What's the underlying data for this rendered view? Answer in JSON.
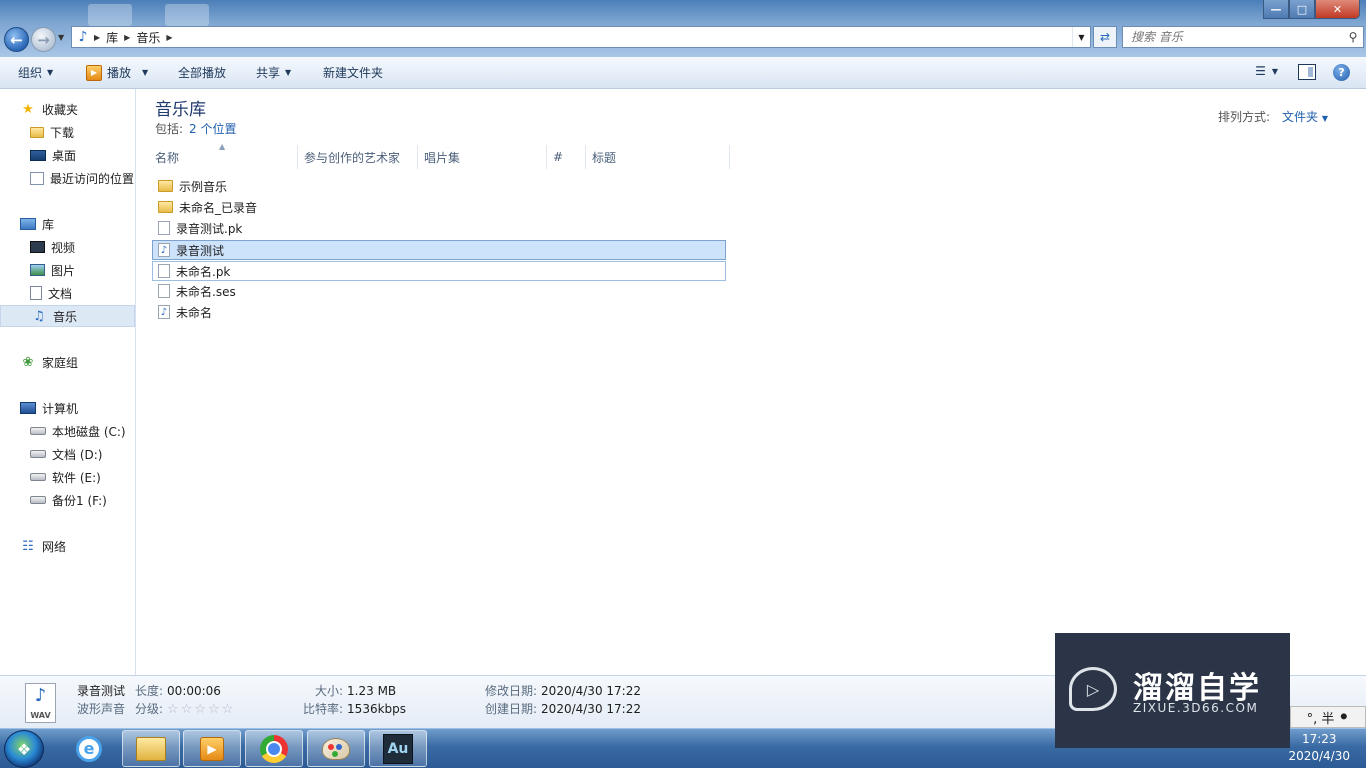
{
  "window": {
    "address_crumbs": [
      "库",
      "音乐"
    ],
    "search_placeholder": "搜索 音乐",
    "controls": {
      "minimize": "—",
      "maximize": "□",
      "close": "✕"
    }
  },
  "toolbar": {
    "organize": "组织",
    "play": "播放",
    "play_all": "全部播放",
    "share": "共享",
    "new_folder": "新建文件夹"
  },
  "sidebar": {
    "favorites": {
      "label": "收藏夹",
      "icon": "star-icon"
    },
    "favorites_items": [
      {
        "label": "下载",
        "icon": "download-folder-icon"
      },
      {
        "label": "桌面",
        "icon": "desktop-icon"
      },
      {
        "label": "最近访问的位置",
        "icon": "recent-places-icon"
      }
    ],
    "libraries": {
      "label": "库",
      "icon": "library-icon"
    },
    "library_items": [
      {
        "label": "视频",
        "icon": "video-library-icon"
      },
      {
        "label": "图片",
        "icon": "pictures-library-icon"
      },
      {
        "label": "文档",
        "icon": "documents-library-icon"
      },
      {
        "label": "音乐",
        "icon": "music-library-icon",
        "selected": true
      }
    ],
    "homegroup": {
      "label": "家庭组",
      "icon": "homegroup-icon"
    },
    "computer": {
      "label": "计算机",
      "icon": "computer-icon"
    },
    "drives": [
      {
        "label": "本地磁盘 (C:)",
        "icon": "system-drive-icon"
      },
      {
        "label": "文档 (D:)",
        "icon": "drive-icon"
      },
      {
        "label": "软件 (E:)",
        "icon": "drive-icon"
      },
      {
        "label": "备份1 (F:)",
        "icon": "drive-icon"
      }
    ],
    "network": {
      "label": "网络",
      "icon": "network-icon"
    }
  },
  "library": {
    "title": "音乐库",
    "includes_label": "包括:",
    "locations_link": "2 个位置",
    "sort_label": "排列方式:",
    "sort_value": "文件夹"
  },
  "columns": [
    "名称",
    "参与创作的艺术家",
    "唱片集",
    "#",
    "标题"
  ],
  "files": [
    {
      "name": "示例音乐",
      "icon": "folder-icon"
    },
    {
      "name": "未命名_已录音",
      "icon": "folder-icon"
    },
    {
      "name": "录音测试.pk",
      "icon": "file-icon"
    },
    {
      "name": "录音测试",
      "icon": "audio-file-icon",
      "state": "selected"
    },
    {
      "name": "未命名.pk",
      "icon": "file-icon",
      "state": "hover"
    },
    {
      "name": "未命名.ses",
      "icon": "file-icon"
    },
    {
      "name": "未命名",
      "icon": "audio-file-icon"
    }
  ],
  "details": {
    "icon_label": "WAV",
    "file_name": "录音测试",
    "file_type": "波形声音",
    "length_label": "长度:",
    "length_value": "00:00:06",
    "rating_label": "分级:",
    "rating_value": 0,
    "size_label": "大小:",
    "size_value": "1.23 MB",
    "bitrate_label": "比特率:",
    "bitrate_value": "1536kbps",
    "modified_label": "修改日期:",
    "modified_value": "2020/4/30 17:22",
    "created_label": "创建日期:",
    "created_value": "2020/4/30 17:22"
  },
  "watermark": {
    "title": "溜溜自学",
    "url": "ZIXUE.3D66.COM"
  },
  "ime": {
    "text": "°, 半"
  },
  "taskbar": {
    "apps": [
      {
        "icon": "explorer-icon",
        "active": true
      },
      {
        "icon": "internet-explorer-icon",
        "active": false
      },
      {
        "icon": "media-player-icon",
        "active": true
      },
      {
        "icon": "chrome-icon",
        "active": true
      },
      {
        "icon": "paint-icon",
        "active": true
      },
      {
        "icon": "audition-icon",
        "label": "Au",
        "active": true
      }
    ],
    "time": "17:23",
    "date": "2020/4/30"
  }
}
